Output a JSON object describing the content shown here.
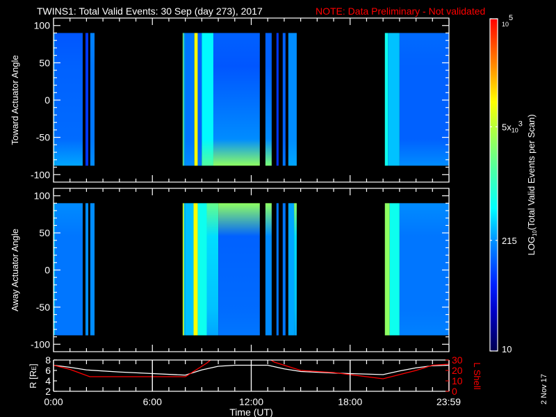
{
  "title": {
    "main": "TWINS1: Total Valid Events: 30 Sep (day 273), 2017",
    "note": "NOTE: Data Preliminary - Not validated"
  },
  "footer_date": "2 Nov 17",
  "chart_data": [
    {
      "type": "heatmap",
      "name": "toward",
      "ylabel": "Toward Actuator Angle",
      "ylim": [
        -110,
        110
      ],
      "yticks": [
        "100",
        "50",
        "0",
        "-50",
        "-100"
      ],
      "ytick_values": [
        100,
        50,
        0,
        -50,
        -100
      ],
      "data_angle_range": [
        -88,
        90
      ],
      "xlim_hours": [
        0,
        24
      ],
      "strips_note": "t0,t1 in UT hours; levels are log10 counts at top / upper-mid / lower-mid / bottom of angle range",
      "strips": [
        {
          "t0": 0.0,
          "t1": 0.1,
          "levels": [
            2.3,
            2.3,
            2.3,
            2.5
          ]
        },
        {
          "t0": 0.1,
          "t1": 1.77,
          "levels": [
            2.05,
            2.1,
            2.15,
            2.4
          ]
        },
        {
          "t0": 1.94,
          "t1": 2.11,
          "levels": [
            1.9,
            1.9,
            1.9,
            1.9
          ]
        },
        {
          "t0": 2.23,
          "t1": 2.49,
          "levels": [
            2.25,
            2.2,
            2.2,
            2.3
          ]
        },
        {
          "t0": 7.84,
          "t1": 7.9,
          "levels": [
            3.4,
            3.4,
            3.4,
            3.4
          ]
        },
        {
          "t0": 7.9,
          "t1": 8.0,
          "levels": [
            2.4,
            2.4,
            2.4,
            2.4
          ]
        },
        {
          "t0": 8.0,
          "t1": 8.55,
          "levels": [
            2.2,
            2.2,
            2.2,
            2.3
          ]
        },
        {
          "t0": 8.55,
          "t1": 8.75,
          "levels": [
            4.0,
            4.0,
            4.0,
            4.0
          ]
        },
        {
          "t0": 8.75,
          "t1": 9.0,
          "levels": [
            2.1,
            2.1,
            2.1,
            2.2
          ]
        },
        {
          "t0": 9.0,
          "t1": 9.7,
          "levels": [
            2.7,
            2.7,
            2.7,
            3.2
          ]
        },
        {
          "t0": 9.7,
          "t1": 12.52,
          "levels": [
            2.1,
            2.05,
            2.3,
            3.5
          ]
        },
        {
          "t0": 12.86,
          "t1": 13.24,
          "levels": [
            2.1,
            2.1,
            2.3,
            3.4
          ]
        },
        {
          "t0": 13.53,
          "t1": 13.66,
          "levels": [
            1.9,
            1.9,
            1.9,
            1.9
          ]
        },
        {
          "t0": 13.91,
          "t1": 14.08,
          "levels": [
            2.1,
            2.1,
            2.1,
            2.2
          ]
        },
        {
          "t0": 14.25,
          "t1": 14.76,
          "levels": [
            2.3,
            2.3,
            2.3,
            2.4
          ]
        },
        {
          "t0": 20.11,
          "t1": 20.3,
          "levels": [
            2.8,
            2.8,
            2.8,
            2.8
          ]
        },
        {
          "t0": 20.3,
          "t1": 21.0,
          "levels": [
            2.5,
            2.5,
            2.5,
            2.5
          ]
        },
        {
          "t0": 21.0,
          "t1": 24.0,
          "levels": [
            2.15,
            2.1,
            2.1,
            2.3
          ]
        }
      ]
    },
    {
      "type": "heatmap",
      "name": "away",
      "ylabel": "Away Actuator Angle",
      "ylim": [
        -110,
        110
      ],
      "yticks": [
        "100",
        "50",
        "0",
        "-50",
        "-100"
      ],
      "ytick_values": [
        100,
        50,
        0,
        -50,
        -100
      ],
      "data_angle_range": [
        -88,
        90
      ],
      "xlim_hours": [
        0,
        24
      ],
      "strips": [
        {
          "t0": 0.0,
          "t1": 0.1,
          "levels": [
            2.5,
            2.5,
            2.5,
            2.5
          ]
        },
        {
          "t0": 0.1,
          "t1": 1.77,
          "levels": [
            2.3,
            2.2,
            2.2,
            2.2
          ]
        },
        {
          "t0": 1.94,
          "t1": 2.11,
          "levels": [
            2.3,
            2.3,
            2.3,
            2.3
          ]
        },
        {
          "t0": 2.23,
          "t1": 2.49,
          "levels": [
            2.3,
            2.3,
            2.3,
            2.3
          ]
        },
        {
          "t0": 7.84,
          "t1": 7.92,
          "levels": [
            3.8,
            3.8,
            3.8,
            3.8
          ]
        },
        {
          "t0": 7.92,
          "t1": 8.0,
          "levels": [
            2.5,
            2.5,
            2.5,
            2.5
          ]
        },
        {
          "t0": 8.0,
          "t1": 8.5,
          "levels": [
            2.5,
            2.5,
            2.5,
            2.5
          ]
        },
        {
          "t0": 8.5,
          "t1": 8.75,
          "levels": [
            4.0,
            4.0,
            4.0,
            4.0
          ]
        },
        {
          "t0": 8.75,
          "t1": 9.3,
          "levels": [
            2.8,
            2.8,
            2.8,
            2.8
          ]
        },
        {
          "t0": 9.3,
          "t1": 10.0,
          "levels": [
            3.3,
            2.6,
            2.5,
            2.4
          ]
        },
        {
          "t0": 10.0,
          "t1": 12.52,
          "levels": [
            3.5,
            2.1,
            2.15,
            2.2
          ]
        },
        {
          "t0": 12.86,
          "t1": 13.24,
          "levels": [
            3.5,
            2.3,
            2.3,
            2.3
          ]
        },
        {
          "t0": 13.53,
          "t1": 13.66,
          "levels": [
            2.2,
            2.2,
            2.2,
            2.2
          ]
        },
        {
          "t0": 13.91,
          "t1": 14.08,
          "levels": [
            2.2,
            2.2,
            2.2,
            2.2
          ]
        },
        {
          "t0": 14.25,
          "t1": 14.6,
          "levels": [
            2.4,
            2.4,
            2.4,
            2.4
          ]
        },
        {
          "t0": 14.6,
          "t1": 14.76,
          "levels": [
            3.5,
            2.6,
            2.5,
            2.4
          ]
        },
        {
          "t0": 20.11,
          "t1": 20.4,
          "levels": [
            3.5,
            3.5,
            3.5,
            3.5
          ]
        },
        {
          "t0": 20.4,
          "t1": 21.0,
          "levels": [
            2.8,
            2.8,
            2.8,
            2.8
          ]
        },
        {
          "t0": 21.0,
          "t1": 24.0,
          "levels": [
            2.3,
            2.2,
            2.2,
            2.25
          ]
        }
      ]
    },
    {
      "type": "line",
      "name": "orbit",
      "xlabel": "Time (UT)",
      "xticks": [
        "0:00",
        "6:00",
        "12:00",
        "18:00",
        "23:59"
      ],
      "xtick_hours": [
        0,
        6,
        12,
        18,
        23.98
      ],
      "ylabel_left": {
        "main": "R [R",
        "sub": "E",
        "end": "]"
      },
      "ylabel_right": "L Shell",
      "yticks_left": [
        "8",
        "6",
        "4",
        "2"
      ],
      "ytick_left_values": [
        8,
        6,
        4,
        2
      ],
      "ylim_left": [
        2,
        8
      ],
      "yticks_right": [
        "30",
        "20",
        "10",
        "0"
      ],
      "ytick_right_values": [
        30,
        20,
        10,
        0
      ],
      "ylim_right": [
        0,
        30
      ],
      "series": [
        {
          "name": "R",
          "color": "#ffffff",
          "axis": "left",
          "x": [
            0,
            1,
            2,
            4,
            6,
            8,
            9,
            10,
            11,
            12,
            13,
            14,
            15,
            17,
            20,
            21,
            22,
            23,
            24
          ],
          "y": [
            7.0,
            6.6,
            6.1,
            5.7,
            5.4,
            5.1,
            6.1,
            6.8,
            7.0,
            7.0,
            7.0,
            6.3,
            5.8,
            5.5,
            5.2,
            5.9,
            6.5,
            6.9,
            7.0
          ]
        },
        {
          "name": "L Shell",
          "color": "#ff0000",
          "axis": "right",
          "x": [
            0,
            1,
            2.2,
            5,
            8,
            9.3,
            9.6,
            13.1,
            13.4,
            15,
            17,
            20,
            22,
            23,
            24
          ],
          "y": [
            25,
            21,
            14,
            14,
            14,
            27,
            31,
            31,
            28,
            20,
            18,
            12,
            20,
            25,
            26
          ]
        }
      ]
    }
  ],
  "colorbar": {
    "label": {
      "pre": "LOG",
      "sub": "10",
      "post": "(Total Valid Events per Scan)"
    },
    "log_range": [
      1,
      5
    ],
    "ticks": [
      {
        "value": 5,
        "mant": "",
        "base": "10",
        "exp": "5"
      },
      {
        "value": 3.699,
        "mant": "5x",
        "base": "10",
        "exp": "3"
      },
      {
        "value": 2.332,
        "mant": "215",
        "base": "",
        "exp": ""
      },
      {
        "value": 1,
        "mant": "10",
        "base": "",
        "exp": ""
      }
    ],
    "colormap": [
      [
        0.0,
        "#000050"
      ],
      [
        0.12,
        "#0000c8"
      ],
      [
        0.2,
        "#0020ff"
      ],
      [
        0.33,
        "#0090ff"
      ],
      [
        0.43,
        "#00ffff"
      ],
      [
        0.55,
        "#50ffa0"
      ],
      [
        0.67,
        "#b4ff3c"
      ],
      [
        0.75,
        "#ffff00"
      ],
      [
        0.87,
        "#ff8000"
      ],
      [
        1.0,
        "#ff0000"
      ]
    ]
  }
}
